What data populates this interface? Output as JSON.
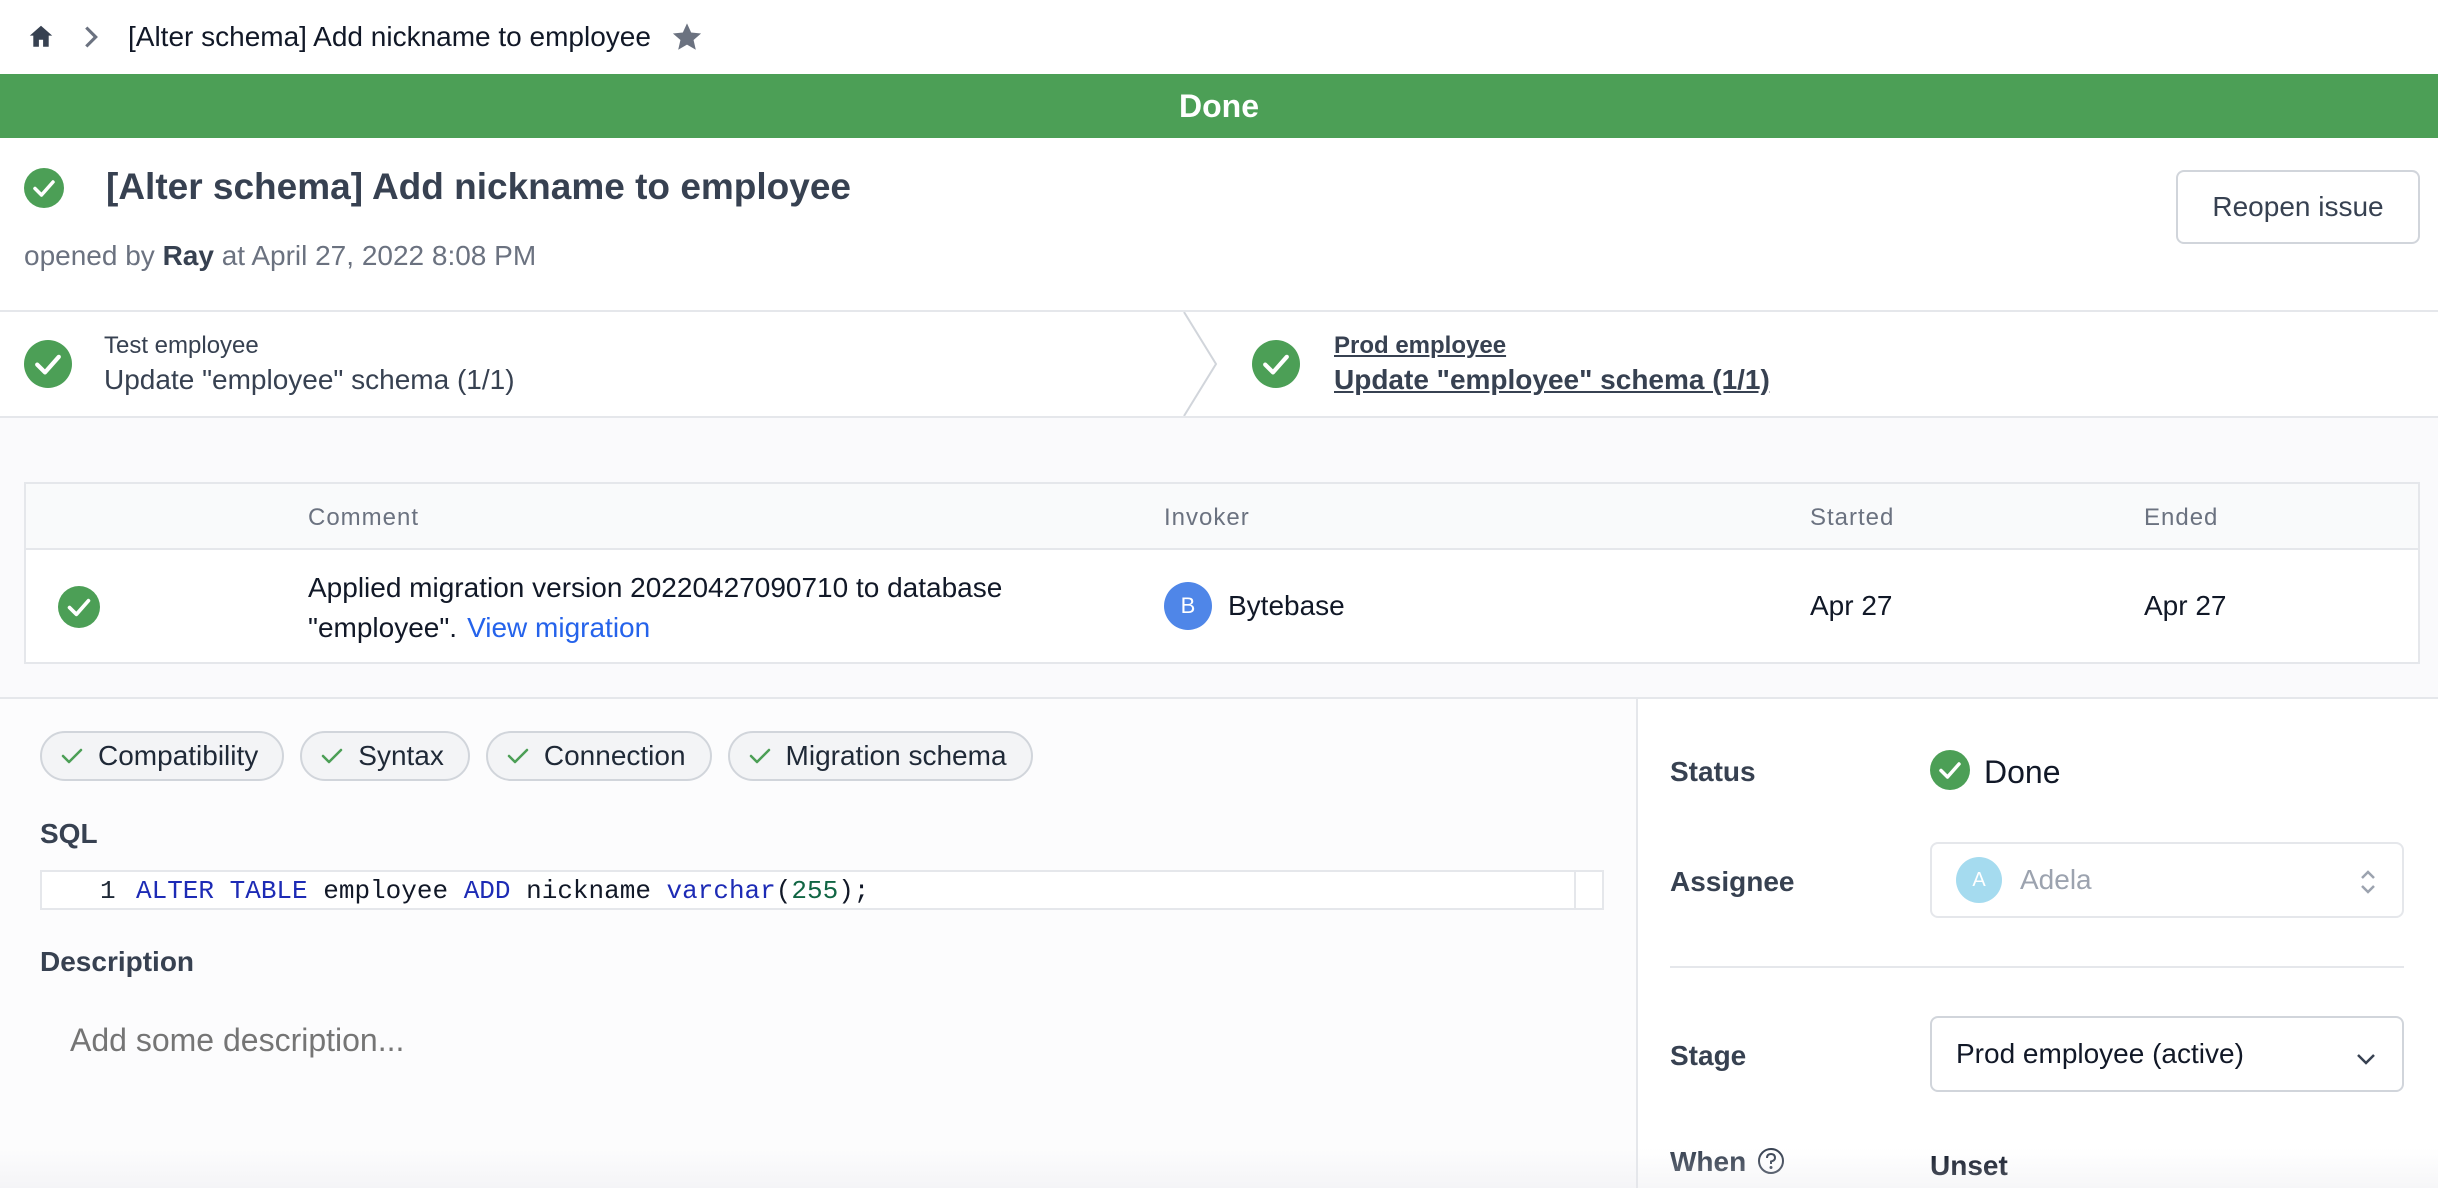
{
  "breadcrumb": {
    "home_icon": "home-icon",
    "chevron_icon": "chevron-right-icon",
    "title": "[Alter schema] Add nickname to employee",
    "star_icon": "star-icon"
  },
  "banner": {
    "text": "Done",
    "color": "#4c9f56"
  },
  "issue": {
    "title": "[Alter schema] Add nickname to employee",
    "opened_prefix": "opened by",
    "author": "Ray",
    "opened_suffix": "at April 27, 2022 8:08 PM",
    "reopen_label": "Reopen issue"
  },
  "pipeline": {
    "stages": [
      {
        "name": "Test employee",
        "desc": "Update \"employee\" schema (1/1)",
        "active": false
      },
      {
        "name": "Prod employee",
        "desc": "Update \"employee\" schema (1/1)",
        "active": true
      }
    ]
  },
  "task_runs": {
    "columns": [
      "Comment",
      "Invoker",
      "Started",
      "Ended"
    ],
    "rows": [
      {
        "comment": "Applied migration version 20220427090710 to database \"employee\".",
        "link": "View migration",
        "invoker_initial": "B",
        "invoker": "Bytebase",
        "started": "Apr 27",
        "ended": "Apr 27"
      }
    ]
  },
  "checks": [
    "Compatibility",
    "Syntax",
    "Connection",
    "Migration schema"
  ],
  "sql": {
    "label": "SQL",
    "line_number": "1",
    "statement": "ALTER TABLE employee ADD nickname varchar(255);"
  },
  "description": {
    "label": "Description",
    "placeholder": "Add some description..."
  },
  "sidebar": {
    "status_label": "Status",
    "status_value": "Done",
    "assignee_label": "Assignee",
    "assignee_initial": "A",
    "assignee_name": "Adela",
    "stage_label": "Stage",
    "stage_value": "Prod employee (active)",
    "when_label": "When",
    "when_value": "Unset"
  },
  "colors": {
    "success": "#4c9f56",
    "link": "#2563eb",
    "invoker_avatar": "#4f86e8",
    "assignee_avatar": "#a5dbef"
  }
}
